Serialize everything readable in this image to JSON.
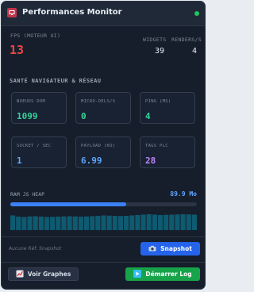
{
  "header": {
    "title": "Performances Monitor"
  },
  "fps": {
    "label": "FPS (MOTEUR UI)",
    "value": "13",
    "color": "#ef4444"
  },
  "widgets": {
    "label": "WIDGETS",
    "value": "39"
  },
  "renders": {
    "label": "RENDERS/S",
    "value": "4"
  },
  "section_title": "SANTÉ NAVIGATEUR & RÉSEAU",
  "cards": [
    {
      "label": "NOEUDS DOM",
      "value": "1099",
      "color": "#34d399"
    },
    {
      "label": "MICRO-DELS/S",
      "value": "0",
      "color": "#34d399"
    },
    {
      "label": "PING (MS)",
      "value": "4",
      "color": "#34d399"
    },
    {
      "label": "SOCKET / SEC",
      "value": "1",
      "color": "#60a5fa"
    },
    {
      "label": "PAYLOAD (KO)",
      "value": "6.99",
      "color": "#60a5fa"
    },
    {
      "label": "TAGS PLC",
      "value": "28",
      "color": "#c084fc"
    }
  ],
  "ram": {
    "label": "RAM JS HEAP",
    "value": "89.9 Mo",
    "fill_percent": 62
  },
  "sparkline": {
    "color": "#0e5a70",
    "levels": [
      0.74,
      0.68,
      0.66,
      0.69,
      0.7,
      0.68,
      0.66,
      0.67,
      0.68,
      0.69,
      0.7,
      0.69,
      0.68,
      0.69,
      0.7,
      0.72,
      0.74,
      0.73,
      0.72,
      0.71,
      0.72,
      0.74,
      0.76,
      0.78,
      0.8,
      0.78,
      0.76,
      0.77,
      0.78,
      0.79,
      0.8,
      0.79,
      0.78
    ]
  },
  "footer": {
    "reference_text": "Aucune Réf. Snapshot",
    "snapshot_button": "Snapshot",
    "graphs_button": "Voir Graphes",
    "log_button": "Démarrer Log"
  },
  "colors": {
    "accent_blue": "#2563eb",
    "accent_green": "#16a34a",
    "status_dot": "#22c55e"
  }
}
